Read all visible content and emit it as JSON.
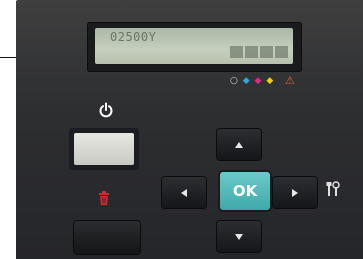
{
  "lcd": {
    "text": "02500Y"
  },
  "ink_icons": {
    "black": "○",
    "cyan": "◆",
    "magenta": "◆",
    "yellow": "◆"
  },
  "alert_icon": "⚠",
  "buttons": {
    "ok_label": "OK",
    "up": "arrow-up",
    "down": "arrow-down",
    "left": "arrow-left",
    "right": "arrow-right"
  },
  "colors": {
    "panel": "#2e2f31",
    "lcd": "#bcc7b3",
    "ok": "#4fb9b9",
    "delete": "#d42a2a",
    "cyan_ink": "#2ea7e0",
    "magenta_ink": "#e0288a",
    "yellow_ink": "#f0d000"
  }
}
